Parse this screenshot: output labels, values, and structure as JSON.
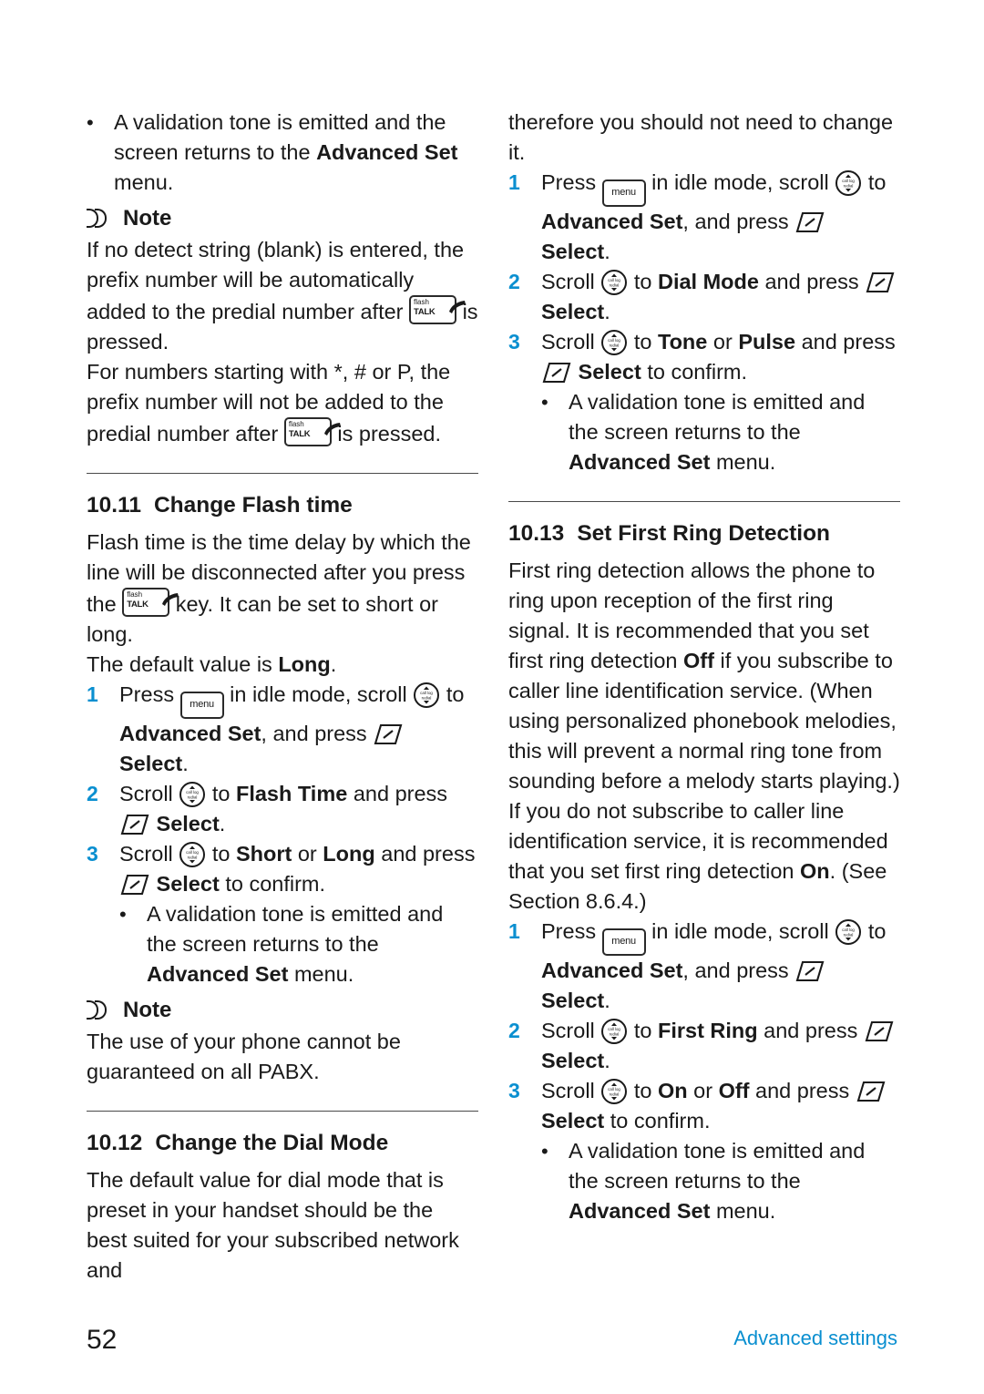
{
  "page": {
    "number": "52",
    "footer_label": "Advanced settings"
  },
  "left_column": {
    "bullet1": {
      "dot": "•",
      "line1": "A validation tone is emitted and",
      "line2": "the screen returns to the",
      "bold": "Advanced Set",
      "line3_rest": " menu."
    },
    "note1": {
      "title": "Note",
      "para1": "If no detect string (blank) is entered, the prefix number will be automatically added to the predial number after",
      "para1_end": "is pressed.",
      "para2": "For numbers starting with *, # or P, the prefix number will not be added to the predial number after",
      "para2_end": "is pressed."
    },
    "section_flash": {
      "number": "10.11",
      "title": "Change Flash time",
      "intro_a": "Flash time is the time delay by which the line will be disconnected after you press the",
      "intro_b": "key. It can be set to short or long.",
      "default_pre": "The default value is ",
      "default_bold": "Long",
      "default_post": ".",
      "step1": {
        "n": "1",
        "t1": "Press",
        "t2": "in idle mode, scroll",
        "t3": "to",
        "b1": "Advanced Set",
        "t4": ", and press",
        "b2": "Select",
        "t5": "."
      },
      "step2": {
        "n": "2",
        "t1": "Scroll",
        "t2": "to",
        "b1": "Flash Time",
        "t3": "and press",
        "b2": "Select",
        "t4": "."
      },
      "step3": {
        "n": "3",
        "t1": "Scroll",
        "t2": "to",
        "b1": "Short",
        "t3": "or",
        "b2": "Long",
        "t4": "and press",
        "b3": "Select",
        "t5": "to confirm."
      },
      "bullet": {
        "dot": "•",
        "line1": "A validation tone is emitted and",
        "line2": "the screen returns to the",
        "bold": "Advanced Set",
        "line3_rest": " menu."
      }
    },
    "note2": {
      "title": "Note",
      "para1": "The use of your phone cannot be guaranteed on all PABX."
    },
    "section_dial": {
      "number": "10.12",
      "title": "Change the Dial Mode",
      "intro": "The default value for dial mode that is preset in your handset should be the best suited for your subscribed network and"
    }
  },
  "right_column": {
    "intro_continued": "therefore you should not need to change it.",
    "section_dial_steps": {
      "step1": {
        "n": "1",
        "t1": "Press",
        "t2": "in idle mode, scroll",
        "t3": "to",
        "b1": "Advanced Set",
        "t4": ", and press",
        "b2": "Select",
        "t5": "."
      },
      "step2": {
        "n": "2",
        "t1": "Scroll",
        "t2": "to",
        "b1": "Dial Mode",
        "t3": "and press",
        "b2": "Select",
        "t4": "."
      },
      "step3": {
        "n": "3",
        "t1": "Scroll",
        "t2": "to",
        "b1": "Tone",
        "t3": "or",
        "b2": "Pulse",
        "t4": "and press",
        "b3": "Select",
        "t5": "to confirm."
      },
      "bullet": {
        "dot": "•",
        "line1": "A validation tone is emitted and",
        "line2": "the screen returns to the",
        "bold": "Advanced Set",
        "line3_rest": " menu."
      }
    },
    "section_first_ring": {
      "number": "10.13",
      "title": "Set First Ring Detection",
      "para_1": "First ring detection allows the phone to ring upon reception of the first ring signal. It is recommended that you set first ring detection ",
      "para_bold_off": "Off",
      "para_2": " if you subscribe to caller line identification service. (When using personalized phonebook melodies, this will prevent a normal ring tone from sounding before a melody starts playing.) If you do not subscribe to caller line identification service, it is recommended that you set first ring detection ",
      "para_bold_on": "On",
      "para_3": ". (See Section 8.6.4.)",
      "step1": {
        "n": "1",
        "t1": "Press",
        "t2": "in idle mode, scroll",
        "t3": "to",
        "b1": "Advanced Set",
        "t4": ", and press",
        "b2": "Select",
        "t5": "."
      },
      "step2": {
        "n": "2",
        "t1": "Scroll",
        "t2": "to",
        "b1": "First Ring",
        "t3": "and press",
        "b2": "Select",
        "t4": "."
      },
      "step3": {
        "n": "3",
        "t1": "Scroll",
        "t2": "to",
        "b1": "On",
        "t3": "or",
        "b2": "Off",
        "t4": "and press",
        "b3": "Select",
        "t5": "to confirm."
      },
      "bullet": {
        "dot": "•",
        "line1": "A validation tone is emitted and",
        "line2": "the screen returns to the",
        "bold": "Advanced Set",
        "line3_rest": " menu."
      }
    }
  },
  "icons": {
    "menu_key_label": "menu",
    "talk_key_label_top": "flash",
    "talk_key_label_bottom": "TALK",
    "scroll_key_label_top": "call log",
    "scroll_key_label_bottom": "redial",
    "select_key": "select-soft-key"
  }
}
